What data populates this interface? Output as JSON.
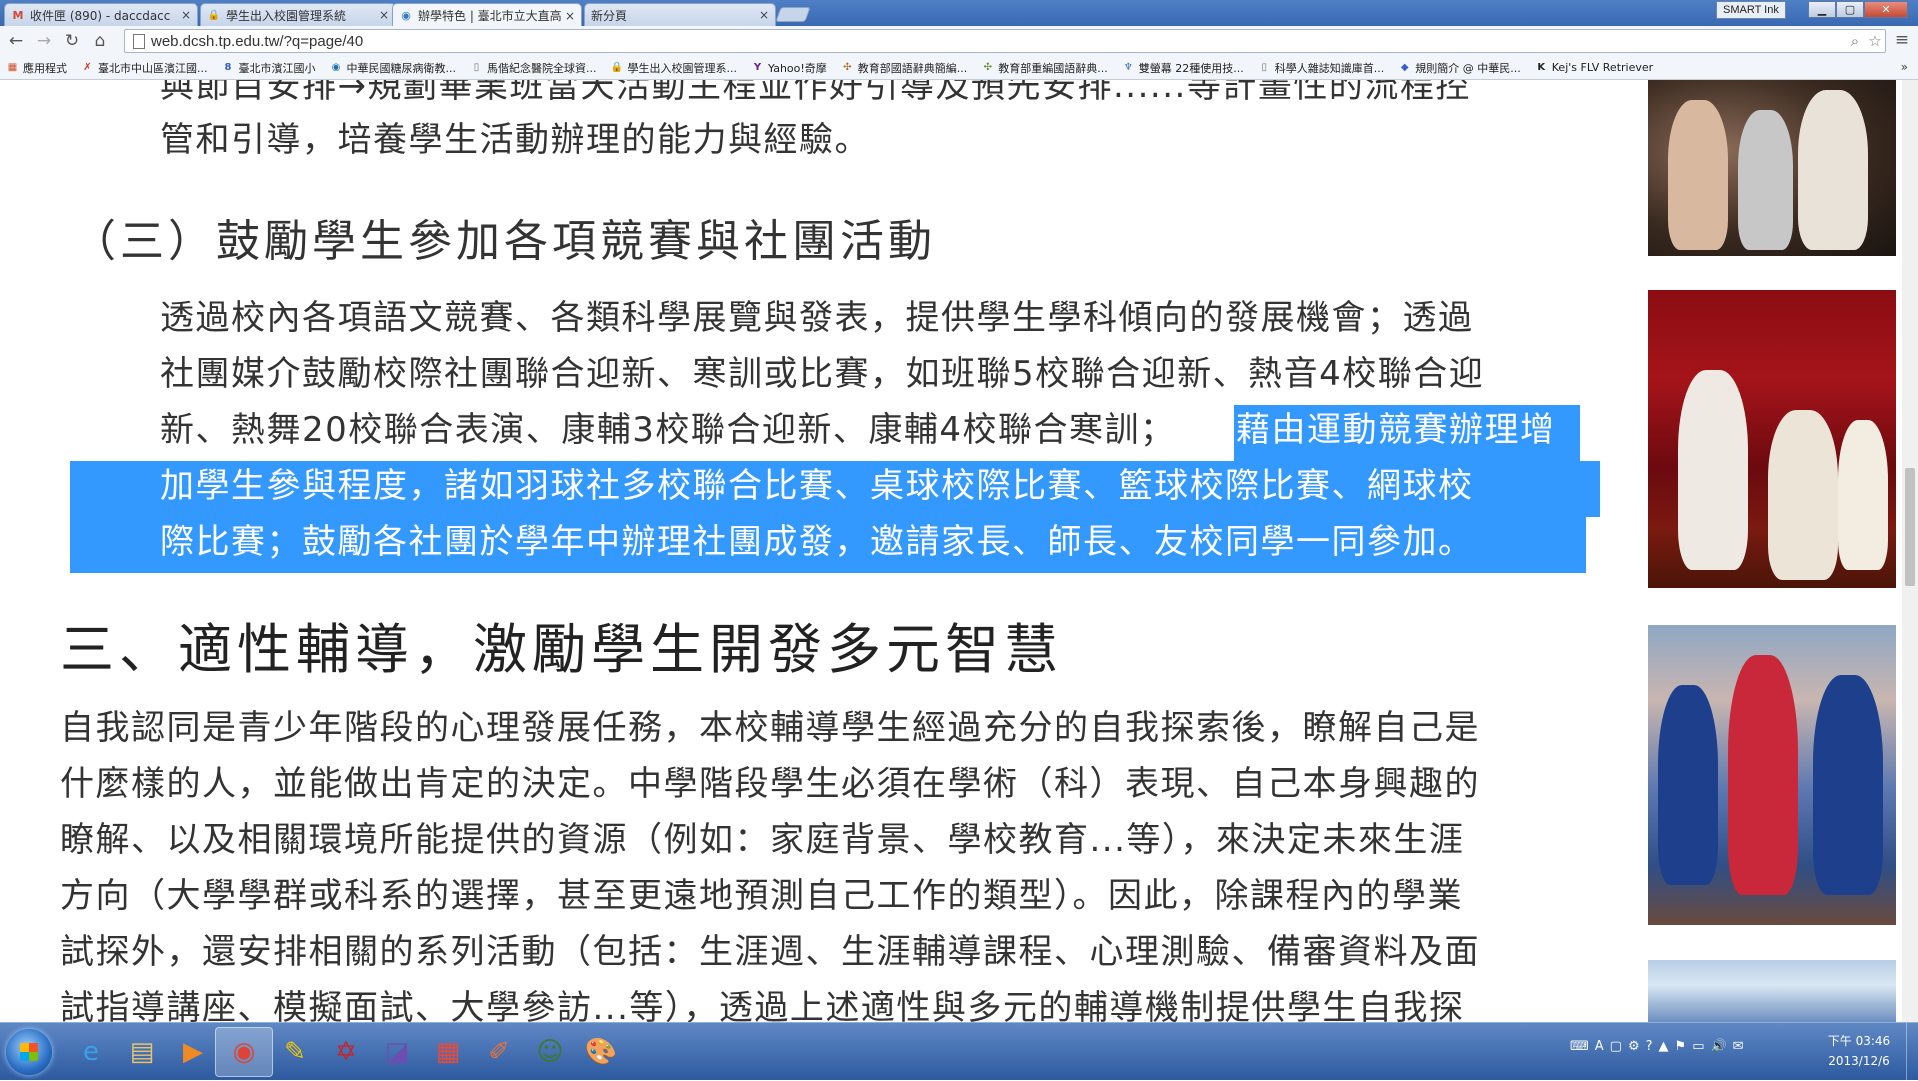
{
  "browser": {
    "tabs": [
      {
        "title": "收件匣 (890) - daccdacc",
        "icon": "gmail-icon",
        "icon_glyph": "M",
        "icon_color": "#d14836"
      },
      {
        "title": "學生出入校園管理系統",
        "icon": "lock-icon",
        "icon_glyph": "🔒",
        "icon_color": "#c79a2a"
      },
      {
        "title": "辦學特色 | 臺北市立大直高",
        "icon": "drupal-icon",
        "icon_glyph": "◉",
        "icon_color": "#2f7bc0"
      },
      {
        "title": "新分頁",
        "icon": "",
        "icon_glyph": "",
        "icon_color": "#333"
      }
    ],
    "tab_close_glyph": "×",
    "smart_ink_label": "SMART Ink",
    "address": "web.dcsh.tp.edu.tw/?q=page/40",
    "bookmarks": [
      {
        "label": "應用程式",
        "icon": "apps-icon",
        "glyph": "▦",
        "color": "#d24c2a"
      },
      {
        "label": "臺北市中山區濱江國...",
        "icon": "bookmark-icon",
        "glyph": "✗",
        "color": "#c0392b"
      },
      {
        "label": "臺北市濱江國小",
        "icon": "bookmark-icon",
        "glyph": "8",
        "color": "#3b5fb8"
      },
      {
        "label": "中華民國糖尿病衛教...",
        "icon": "bookmark-icon",
        "glyph": "◉",
        "color": "#1a73a8"
      },
      {
        "label": "馬偕紀念醫院全球資...",
        "icon": "page-icon",
        "glyph": "▯",
        "color": "#777"
      },
      {
        "label": "學生出入校園管理系...",
        "icon": "lock-icon",
        "glyph": "🔒",
        "color": "#c79a2a"
      },
      {
        "label": "Yahoo!奇摩",
        "icon": "yahoo-icon",
        "glyph": "Y",
        "color": "#5f1f9b"
      },
      {
        "label": "教育部國語辭典簡編...",
        "icon": "bookmark-icon",
        "glyph": "✣",
        "color": "#a66a1c"
      },
      {
        "label": "教育部重編國語辭典...",
        "icon": "bookmark-icon",
        "glyph": "✣",
        "color": "#5c8a2a"
      },
      {
        "label": "雙螢幕 22種使用技...",
        "icon": "bookmark-icon",
        "glyph": "♆",
        "color": "#3a6fb0"
      },
      {
        "label": "科學人雜誌知識庫首...",
        "icon": "page-icon",
        "glyph": "▯",
        "color": "#777"
      },
      {
        "label": "規則簡介 @ 中華民...",
        "icon": "bookmark-icon",
        "glyph": "◆",
        "color": "#3a5fcf"
      },
      {
        "label": "Kej's FLV Retriever",
        "icon": "bookmark-icon",
        "glyph": "K",
        "color": "#222"
      }
    ],
    "bookmarks_more": "»"
  },
  "article": {
    "partial_top_line": "與節目安排→規劃畢業班當天活動主程並作好引導及預先安排......等計畫性的流程控",
    "line_2": "管和引導，培養學生活動辦理的能力與經驗。",
    "subsection_heading": "（三）鼓勵學生參加各項競賽與社團活動",
    "p2_lines": [
      "透過校內各項語文競賽、各類科學展覽與發表，提供學生學科傾向的發展機會；透過",
      "社團媒介鼓勵校際社團聯合迎新、寒訓或比賽，如班聯5校聯合迎新、熱音4校聯合迎",
      "新、熱舞20校聯合表演、康輔3校聯合迎新、康輔4校聯合寒訓；"
    ],
    "p2_selected_lines": [
      "藉由運動競賽辦理增",
      "加學生參與程度，諸如羽球社多校聯合比賽、桌球校際比賽、籃球校際比賽、網球校",
      "際比賽；鼓勵各社團於學年中辦理社團成發，邀請家長、師長、友校同學一同參加。"
    ],
    "section_heading": "三、適性輔導，激勵學生開發多元智慧",
    "p3_lines": [
      "自我認同是青少年階段的心理發展任務，本校輔導學生經過充分的自我探索後，瞭解自己是",
      "什麼樣的人，並能做出肯定的決定。中學階段學生必須在學術（科）表現、自己本身興趣的",
      "瞭解、以及相關環境所能提供的資源（例如：家庭背景、學校教育...等），來決定未來生涯",
      "方向（大學學群或科系的選擇，甚至更遠地預測自己工作的類型）。因此，除課程內的學業",
      "試探外，還安排相關的系列活動（包括：生涯週、生涯輔導課程、心理測驗、備審資料及面",
      "試指導講座、模擬面試、大學參訪...等），透過上述適性與多元的輔導機制提供學生自我探"
    ],
    "selection_color": "#3399ff"
  },
  "taskbar": {
    "apps": [
      {
        "name": "internet-explorer-icon",
        "glyph": "e",
        "color": "#3aa0e8",
        "active": false
      },
      {
        "name": "file-explorer-icon",
        "glyph": "▤",
        "color": "#e8c36a",
        "active": false
      },
      {
        "name": "media-player-icon",
        "glyph": "▶",
        "color": "#f08a24",
        "active": false
      },
      {
        "name": "chrome-icon",
        "glyph": "◉",
        "color": "#db4437",
        "active": true
      },
      {
        "name": "smart-notebook-icon",
        "glyph": "✎",
        "color": "#f2c500",
        "active": false
      },
      {
        "name": "network-app-icon",
        "glyph": "✡",
        "color": "#d02020",
        "active": false
      },
      {
        "name": "screen-tool-icon",
        "glyph": "◪",
        "color": "#6a4fb0",
        "active": false
      },
      {
        "name": "app-grid-icon",
        "glyph": "▦",
        "color": "#e84a3c",
        "active": false
      },
      {
        "name": "edraw-icon",
        "glyph": "✐",
        "color": "#e8733a",
        "active": false
      },
      {
        "name": "character-app-icon",
        "glyph": "☺",
        "color": "#3a7a2a",
        "active": false
      },
      {
        "name": "paint-icon",
        "glyph": "🎨",
        "color": "#f2f2f2",
        "active": false
      }
    ],
    "tray_glyphs": [
      "⌨",
      "A",
      "▢",
      "⚙",
      "?",
      "▲",
      "⚑",
      "▭",
      "🔊",
      "✉"
    ],
    "clock_time": "下午 03:46",
    "clock_date": "2013/12/6"
  }
}
